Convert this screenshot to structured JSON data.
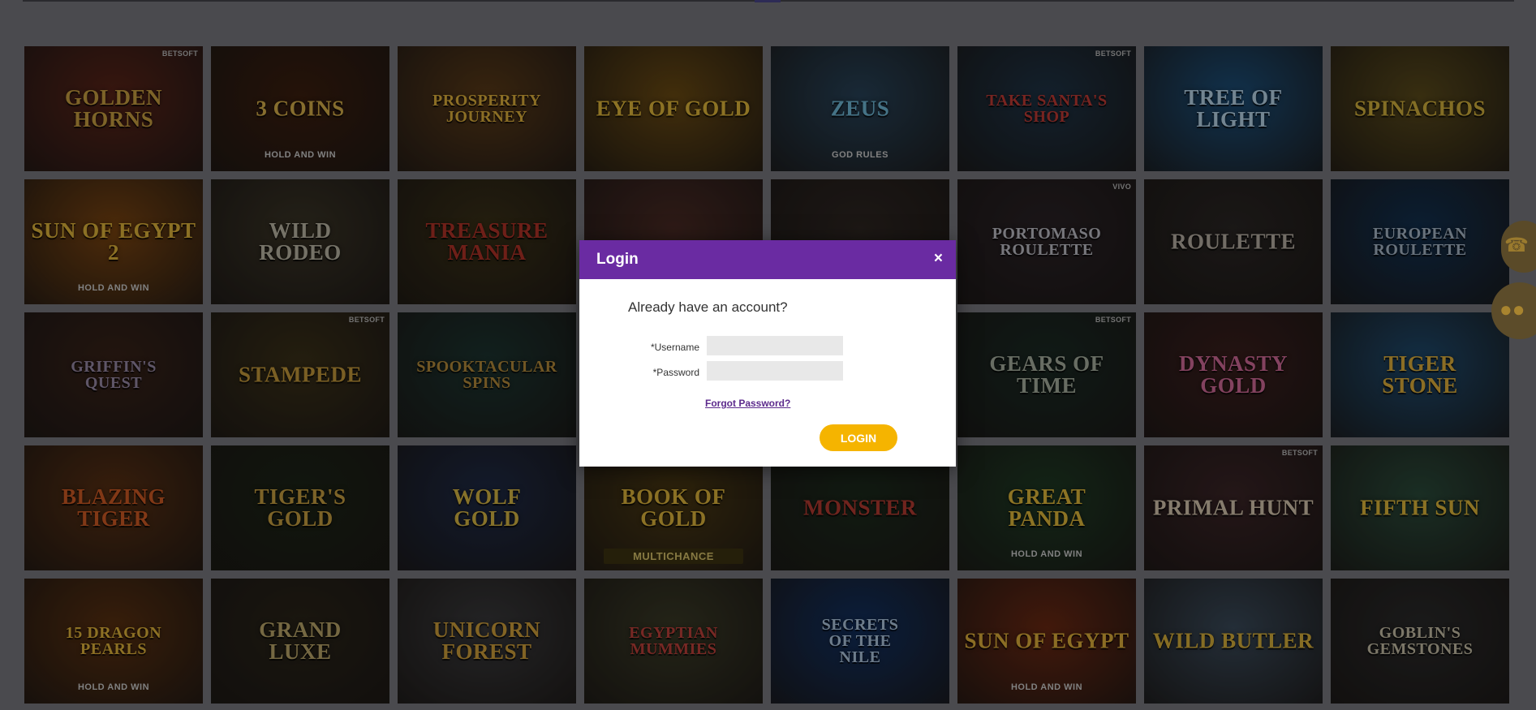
{
  "modal": {
    "title": "Login",
    "close": "×",
    "heading": "Already have an account?",
    "username_label": "*Username",
    "password_label": "*Password",
    "username_value": "",
    "password_value": "",
    "forgot": "Forgot Password?",
    "submit": "LOGIN"
  },
  "floating_icons": [
    "chat-icon",
    "coins-icon"
  ],
  "colors": {
    "modal_header": "#6a2ba2",
    "login_button": "#f5b400",
    "link": "#5c2a8c",
    "overlay": "#4a4a4e"
  },
  "games": [
    [
      {
        "title": "Golden\nHorns",
        "badge": "BETSOFT",
        "bg": "#5a2418",
        "fg": "#c9a040"
      },
      {
        "title": "3 Coins",
        "sub": "HOLD AND WIN",
        "bg": "#3b1e0e",
        "fg": "#d8b04a"
      },
      {
        "title": "Prosperity\nJourney",
        "bg": "#5a3a18",
        "fg": "#e0b23c"
      },
      {
        "title": "Eye of Gold",
        "bg": "#6a4a12",
        "fg": "#e2b83a"
      },
      {
        "title": "Zeus",
        "sub": "GOD RULES",
        "bg": "#274258",
        "fg": "#6fb9d8"
      },
      {
        "title": "Take Santa's\nShop",
        "badge": "BETSOFT",
        "bg": "#1e3346",
        "fg": "#c23a34"
      },
      {
        "title": "Tree of Light",
        "bg": "#1c4f7a",
        "fg": "#b9d6ea"
      },
      {
        "title": "SpiNachos",
        "bg": "#5a4a1a",
        "fg": "#d4b13c"
      }
    ],
    [
      {
        "title": "Sun of Egypt 2",
        "sub": "HOLD AND WIN",
        "bg": "#7a4410",
        "fg": "#e0b43a"
      },
      {
        "title": "Wild\nRodeo",
        "bg": "#3a3426",
        "fg": "#bdb8a6"
      },
      {
        "title": "Treasure\nMania",
        "bg": "#3a3016",
        "fg": "#b23226"
      },
      {
        "title": "",
        "bg": "#4a2a24",
        "fg": "#c9a040"
      },
      {
        "title": "",
        "bg": "#2e2622",
        "fg": "#c9a040"
      },
      {
        "title": "Portomaso\nRoulette",
        "badge": "VIVO",
        "bg": "#2a2226",
        "fg": "#c0c0c8"
      },
      {
        "title": "Roulette",
        "bg": "#2a2624",
        "fg": "#b8b0a4"
      },
      {
        "title": "European\nRoulette",
        "bg": "#123050",
        "fg": "#a8b8c8"
      }
    ],
    [
      {
        "title": "Griffin's\nQuest",
        "bg": "#382218",
        "fg": "#9a8aa8"
      },
      {
        "title": "Stampede",
        "badge": "BETSOFT",
        "bg": "#3a3018",
        "fg": "#c49a3a"
      },
      {
        "title": "Spooktacular\nSpins",
        "bg": "#1c3430",
        "fg": "#b48a3a"
      },
      {
        "title": "",
        "bg": "#3c3a38",
        "fg": "#c9a040"
      },
      {
        "title": "",
        "bg": "#3c3a38",
        "fg": "#c9a040"
      },
      {
        "title": "Gears of Time",
        "badge": "BETSOFT",
        "bg": "#1a2a24",
        "fg": "#a8b0a0"
      },
      {
        "title": "Dynasty\nGold",
        "bg": "#3a1e1c",
        "fg": "#d46a9a"
      },
      {
        "title": "Tiger\nStone",
        "bg": "#1e4a6e",
        "fg": "#e0b03a"
      }
    ],
    [
      {
        "title": "Blazing\nTiger",
        "bg": "#5a3012",
        "fg": "#d05a24"
      },
      {
        "title": "Tiger's\nGold",
        "bg": "#1c2416",
        "fg": "#c8a040"
      },
      {
        "title": "Wolf\nGold",
        "bg": "#1e2a46",
        "fg": "#d8b844"
      },
      {
        "title": "Book of Gold",
        "sub": "MULTICHANCE",
        "bg": "#4a3812",
        "fg": "#e0b63c"
      },
      {
        "title": "Monster",
        "bg": "#1c2a1c",
        "fg": "#b43a30"
      },
      {
        "title": "Great\nPanda",
        "sub": "HOLD AND WIN",
        "bg": "#1e3a24",
        "fg": "#e2ba3a"
      },
      {
        "title": "Primal Hunt",
        "badge": "BETSOFT",
        "bg": "#3a2426",
        "fg": "#d8c8b0"
      },
      {
        "title": "Fifth Sun",
        "bg": "#2a4a3a",
        "fg": "#e0b83a"
      }
    ],
    [
      {
        "title": "15 Dragon\nPearls",
        "sub": "HOLD AND WIN",
        "bg": "#5a3010",
        "fg": "#e2b43a"
      },
      {
        "title": "Grand\nLuxe",
        "bg": "#2a2418",
        "fg": "#bca86a"
      },
      {
        "title": "Unicorn Forest",
        "bg": "#3a3a3c",
        "fg": "#d0a03a"
      },
      {
        "title": "Egyptian Mummies",
        "bg": "#3a3a26",
        "fg": "#c0403a"
      },
      {
        "title": "Secrets\nof the\nNile",
        "bg": "#123060",
        "fg": "#b0c8e0"
      },
      {
        "title": "Sun of Egypt",
        "sub": "HOLD AND WIN",
        "bg": "#6a2812",
        "fg": "#e0b03a"
      },
      {
        "title": "Wild Butler",
        "bg": "#3a4a5a",
        "fg": "#d8b03a"
      },
      {
        "title": "Goblin's\nGemstones",
        "bg": "#2a2a2a",
        "fg": "#c8c0a8"
      }
    ]
  ]
}
